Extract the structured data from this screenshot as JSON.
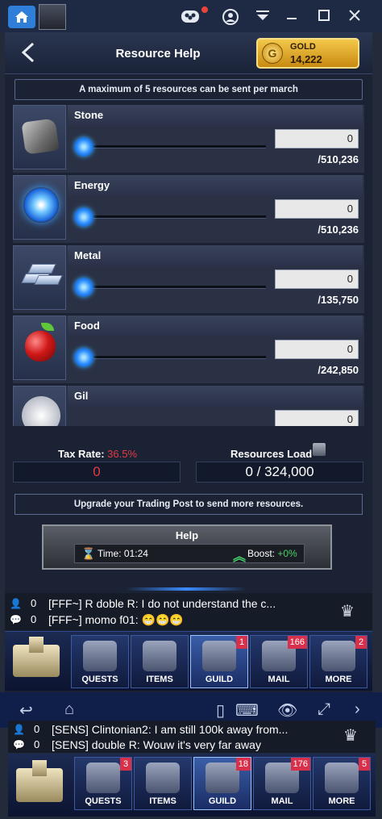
{
  "header": {
    "title": "Resource Help",
    "gold_label": "GOLD",
    "gold_value": "14,222"
  },
  "notice": "A maximum of 5 resources can be sent per march",
  "resources": [
    {
      "name": "Stone",
      "value": "0",
      "max": "/510,236"
    },
    {
      "name": "Energy",
      "value": "0",
      "max": "/510,236"
    },
    {
      "name": "Metal",
      "value": "0",
      "max": "/135,750"
    },
    {
      "name": "Food",
      "value": "0",
      "max": "/242,850"
    },
    {
      "name": "Gil",
      "value": "0",
      "max": ""
    }
  ],
  "tax": {
    "label": "Tax Rate: ",
    "rate": "36.5%",
    "value": "0"
  },
  "load": {
    "label": "Resources Load",
    "value": "0 / 324,000"
  },
  "upgrade_notice": "Upgrade your Trading Post to send more resources.",
  "help": {
    "title": "Help",
    "time": "Time: 01:24",
    "boost_label": "Boost: ",
    "boost_value": "+0%"
  },
  "chat": [
    {
      "count": "0",
      "text": "[FFF~] R doble R: I do not understand the c..."
    },
    {
      "count": "0",
      "text": "[FFF~] momo f01: 😁😁😁"
    }
  ],
  "nav": [
    {
      "label": "",
      "badge": ""
    },
    {
      "label": "QUESTS",
      "badge": ""
    },
    {
      "label": "ITEMS",
      "badge": ""
    },
    {
      "label": "GUILD",
      "badge": "1"
    },
    {
      "label": "MAIL",
      "badge": "166"
    },
    {
      "label": "MORE",
      "badge": "2"
    }
  ],
  "chat2": [
    {
      "count": "0",
      "text": "[SENS] Clintonian2: I am still 100k away from..."
    },
    {
      "count": "0",
      "text": "[SENS] double R: Wouw it's very far away"
    }
  ],
  "nav2": [
    {
      "label": "",
      "badge": ""
    },
    {
      "label": "QUESTS",
      "badge": "3"
    },
    {
      "label": "ITEMS",
      "badge": ""
    },
    {
      "label": "GUILD",
      "badge": "18"
    },
    {
      "label": "MAIL",
      "badge": "176"
    },
    {
      "label": "MORE",
      "badge": "5"
    }
  ]
}
